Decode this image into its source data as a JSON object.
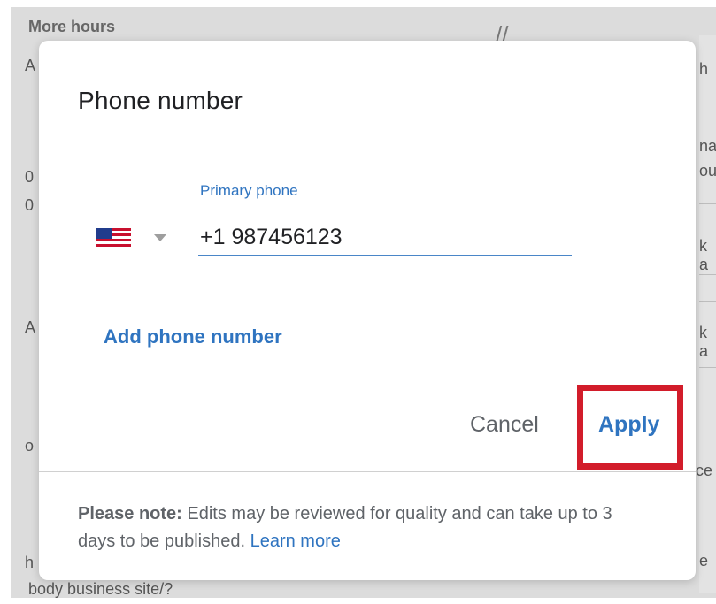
{
  "background": {
    "top_text": "More hours",
    "partial_right_chars": [
      "h",
      "na",
      "ou",
      "k a",
      "k a",
      "e",
      "ce"
    ],
    "partial_left_chars": [
      "A",
      "0",
      "0",
      "A",
      "o",
      "h"
    ],
    "bottom_text": "body business site/?"
  },
  "dialog": {
    "title": "Phone number",
    "primary_phone": {
      "label": "Primary phone",
      "country_flag": "us-flag-icon",
      "value": "+1 987456123"
    },
    "add_phone_label": "Add phone number",
    "buttons": {
      "cancel": "Cancel",
      "apply": "Apply"
    },
    "note": {
      "prefix": "Please note:",
      "text": " Edits may be reviewed for quality and can take up to 3 days to be published. ",
      "link": "Learn more"
    }
  },
  "colors": {
    "accent": "#2f74c0",
    "highlight": "#d21c2a",
    "overlay": "#dcdcdc"
  }
}
